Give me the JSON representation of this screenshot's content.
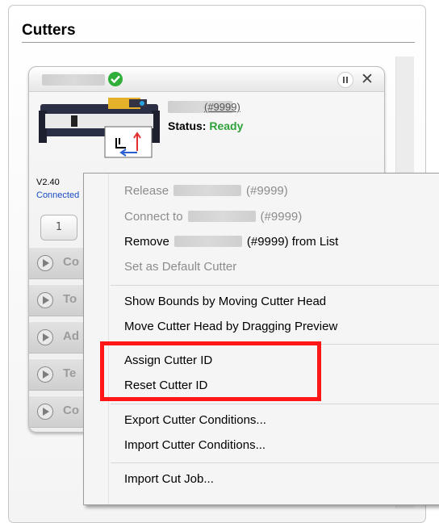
{
  "panel": {
    "title": "Cutters"
  },
  "cutter": {
    "link_text": "(#9999)",
    "status_label": "Status:",
    "status_value": "Ready",
    "version": "V2.40",
    "connected_text": "Connected",
    "page_tab": "1"
  },
  "sections": [
    {
      "label": "Co"
    },
    {
      "label": "To"
    },
    {
      "label": "Ad"
    },
    {
      "label": "Te"
    },
    {
      "label": "Co"
    }
  ],
  "context_menu": {
    "release_prefix": "Release",
    "release_suffix": "(#9999)",
    "connect_prefix": "Connect to",
    "connect_suffix": "(#9999)",
    "remove_prefix": "Remove",
    "remove_suffix": "(#9999) from List",
    "set_default": "Set as Default Cutter",
    "show_bounds": "Show Bounds by Moving Cutter Head",
    "move_head": "Move Cutter Head by Dragging Preview",
    "assign_id": "Assign Cutter ID",
    "reset_id": "Reset Cutter ID",
    "export_conditions": "Export Cutter Conditions...",
    "import_conditions": "Import Cutter Conditions...",
    "import_cut_job": "Import Cut Job..."
  },
  "colors": {
    "status_ready": "#2fa23a",
    "connected_link": "#1a4cc4",
    "highlight_box": "#ff1616"
  }
}
